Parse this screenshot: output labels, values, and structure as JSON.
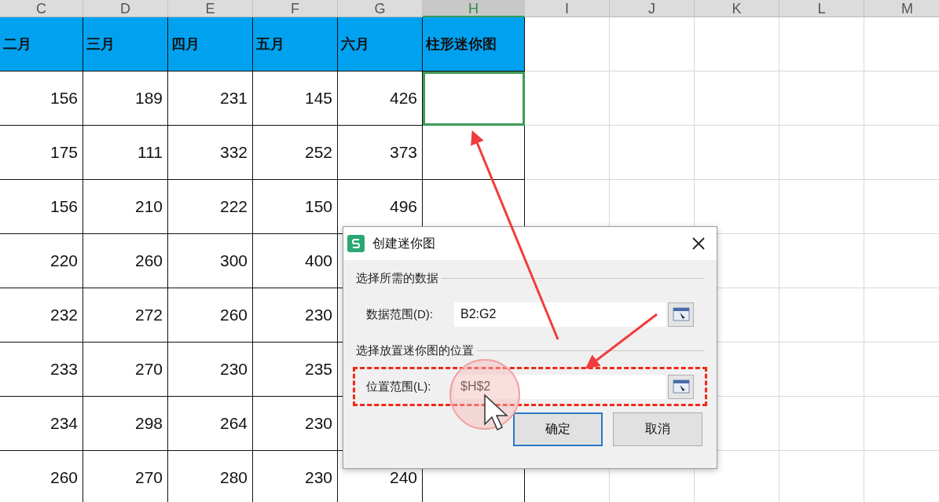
{
  "columns": [
    {
      "letter": "C",
      "selected": false
    },
    {
      "letter": "D",
      "selected": false
    },
    {
      "letter": "E",
      "selected": false
    },
    {
      "letter": "F",
      "selected": false
    },
    {
      "letter": "G",
      "selected": false
    },
    {
      "letter": "H",
      "selected": true
    },
    {
      "letter": "I",
      "selected": false
    },
    {
      "letter": "J",
      "selected": false
    },
    {
      "letter": "K",
      "selected": false
    },
    {
      "letter": "L",
      "selected": false
    },
    {
      "letter": "M",
      "selected": false
    }
  ],
  "header_row": [
    "二月",
    "三月",
    "四月",
    "五月",
    "六月",
    "柱形迷你图"
  ],
  "rows": [
    {
      "values": [
        "156",
        "189",
        "231",
        "145",
        "426"
      ],
      "selected": true
    },
    {
      "values": [
        "175",
        "111",
        "332",
        "252",
        "373"
      ],
      "selected": false
    },
    {
      "values": [
        "156",
        "210",
        "222",
        "150",
        "496"
      ],
      "selected": false
    },
    {
      "values": [
        "220",
        "260",
        "300",
        "400"
      ],
      "selected": false
    },
    {
      "values": [
        "232",
        "272",
        "260",
        "230"
      ],
      "selected": false
    },
    {
      "values": [
        "233",
        "270",
        "230",
        "235"
      ],
      "selected": false
    },
    {
      "values": [
        "234",
        "298",
        "264",
        "230"
      ],
      "selected": false
    },
    {
      "values": [
        "260",
        "270",
        "280",
        "230",
        "240"
      ],
      "selected": false
    }
  ],
  "dialog": {
    "title": "创建迷你图",
    "sections": [
      {
        "legend": "选择所需的数据",
        "label": "数据范围(D):",
        "value": "B2:G2",
        "highlighted": false
      },
      {
        "legend": "选择放置迷你图的位置",
        "label": "位置范围(L):",
        "value": "$H$2",
        "highlighted": true
      }
    ],
    "buttons": [
      {
        "label": "确定",
        "default": true
      },
      {
        "label": "取消",
        "default": false
      }
    ]
  }
}
